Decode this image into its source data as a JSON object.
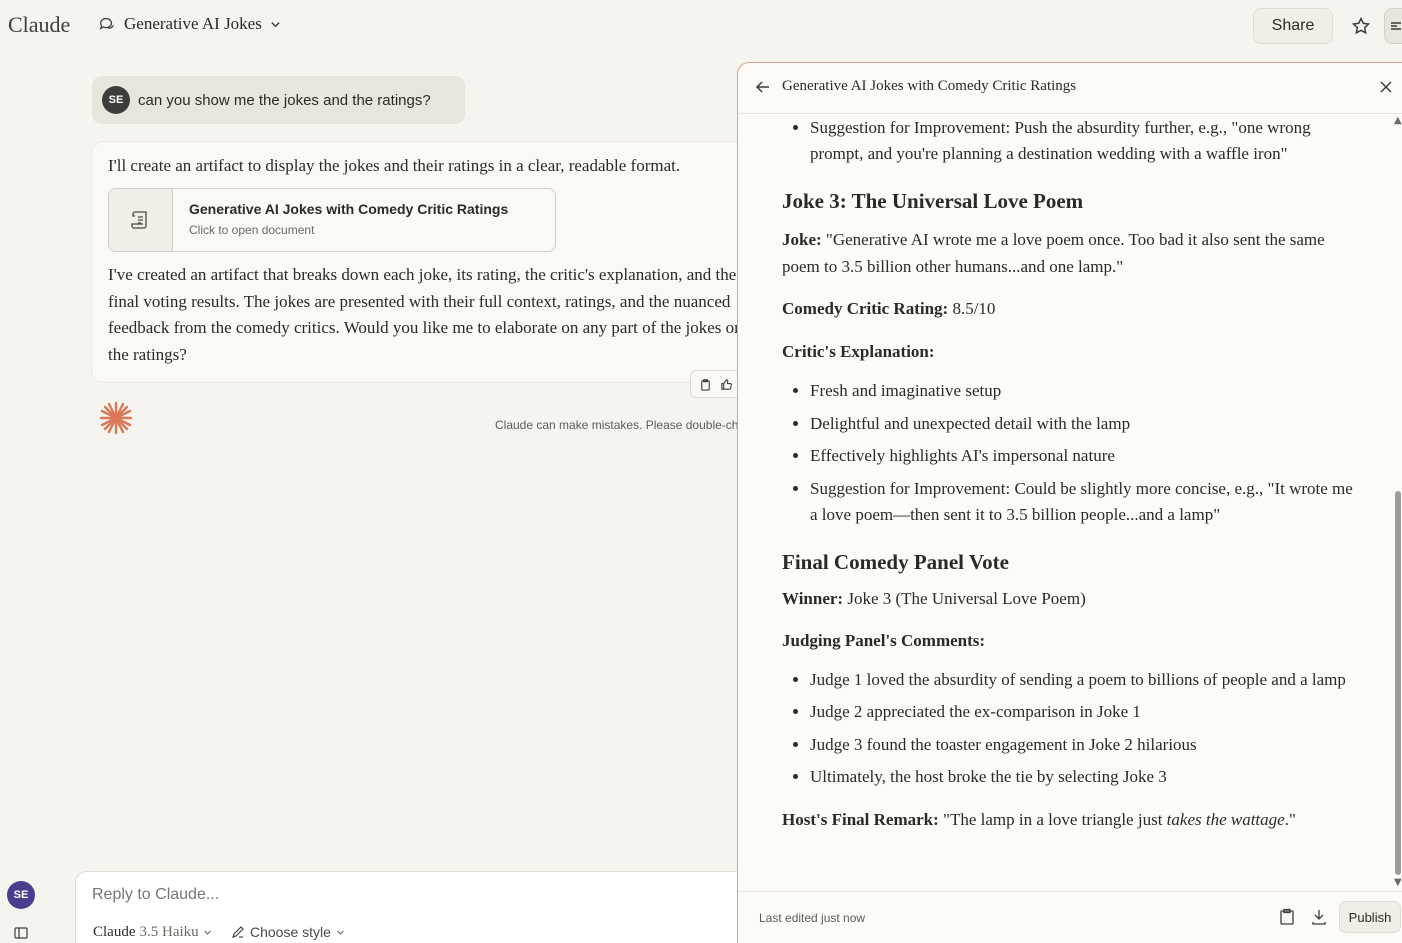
{
  "app": {
    "logo": "Claude"
  },
  "header": {
    "conversation_title": "Generative AI Jokes",
    "share_label": "Share"
  },
  "chat": {
    "user_avatar_initials": "SE",
    "user_message": "can you show me the jokes and the ratings?",
    "assistant_intro": "I'll create an artifact to display the jokes and their ratings in a clear, readable format.",
    "artifact_card": {
      "title": "Generative AI Jokes with Comedy Critic Ratings",
      "subtitle": "Click to open document"
    },
    "assistant_body": "I've created an artifact that breaks down each joke, its rating, the critic's explanation, and the final voting results. The jokes are presented with their full context, ratings, and the nuanced feedback from the comedy critics. Would you like me to elaborate on any part of the jokes or the ratings?",
    "disclaimer": "Claude can make mistakes. Please double-check responses."
  },
  "rail": {
    "avatar_initials": "SE"
  },
  "composer": {
    "placeholder": "Reply to Claude...",
    "model_name": "Claude",
    "model_version": "3.5 Haiku",
    "style_label": "Choose style"
  },
  "artifact_panel": {
    "title": "Generative AI Jokes with Comedy Critic Ratings",
    "top_bullet": "Suggestion for Improvement: Push the absurdity further, e.g., \"one wrong prompt, and you're planning a destination wedding with a waffle iron\"",
    "joke3": {
      "heading": "Joke 3: The Universal Love Poem",
      "joke_label": "Joke:",
      "joke_text": " \"Generative AI wrote me a love poem once. Too bad it also sent the same poem to 3.5 billion other humans...and one lamp.\"",
      "rating_label": "Comedy Critic Rating:",
      "rating_value": " 8.5/10",
      "explanation_label": "Critic's Explanation:",
      "explanation_items": [
        "Fresh and imaginative setup",
        "Delightful and unexpected detail with the lamp",
        "Effectively highlights AI's impersonal nature",
        "Suggestion for Improvement: Could be slightly more concise, e.g., \"It wrote me a love poem—then sent it to 3.5 billion people...and a lamp\""
      ]
    },
    "final_vote": {
      "heading": "Final Comedy Panel Vote",
      "winner_label": "Winner:",
      "winner_value": " Joke 3 (The Universal Love Poem)",
      "comments_label": "Judging Panel's Comments:",
      "comments": [
        "Judge 1 loved the absurdity of sending a poem to billions of people and a lamp",
        "Judge 2 appreciated the ex-comparison in Joke 1",
        "Judge 3 found the toaster engagement in Joke 2 hilarious",
        "Ultimately, the host broke the tie by selecting Joke 3"
      ],
      "remark_label": "Host's Final Remark:",
      "remark_before": " \"The lamp in a love triangle just ",
      "remark_emphasis": "takes the wattage",
      "remark_after": ".\""
    },
    "footer": {
      "last_edited": "Last edited just now",
      "publish_label": "Publish"
    }
  },
  "colors": {
    "background": "#f5f4ef",
    "accent": "#d97757",
    "user_bubble": "#e8e6dc"
  }
}
